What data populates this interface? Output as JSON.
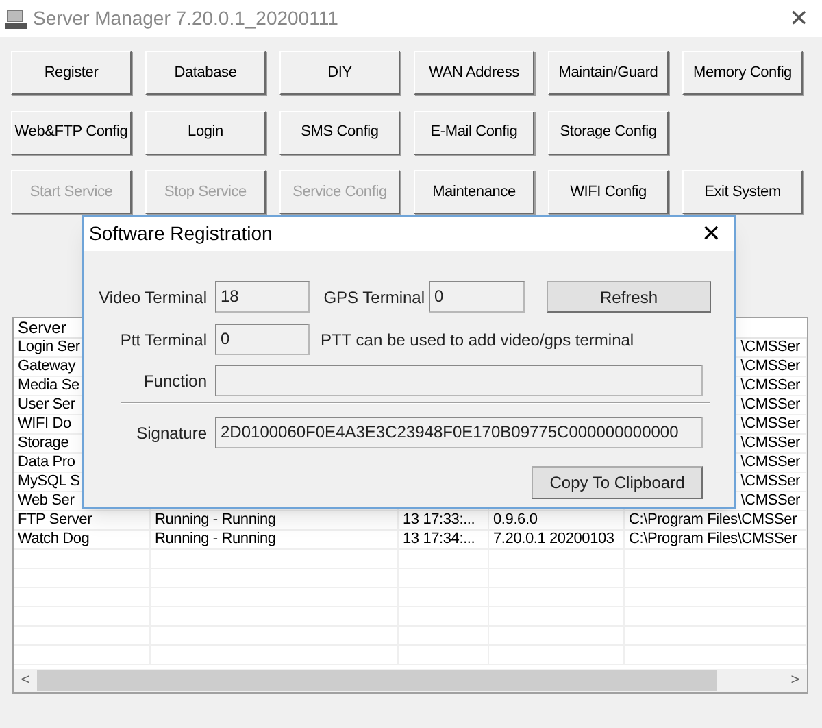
{
  "window": {
    "title": "Server Manager 7.20.0.1_20200111",
    "close": "✕"
  },
  "buttons": [
    {
      "label": "Register",
      "disabled": false
    },
    {
      "label": "Database",
      "disabled": false
    },
    {
      "label": "DIY",
      "disabled": false
    },
    {
      "label": "WAN Address",
      "disabled": false
    },
    {
      "label": "Maintain/Guard",
      "disabled": false
    },
    {
      "label": "Memory Config",
      "disabled": false
    },
    {
      "label": "Web&FTP Config",
      "disabled": false
    },
    {
      "label": "Login",
      "disabled": false
    },
    {
      "label": "SMS Config",
      "disabled": false
    },
    {
      "label": "E-Mail Config",
      "disabled": false
    },
    {
      "label": "Storage Config",
      "disabled": false
    },
    {
      "label": "Start Service",
      "disabled": true
    },
    {
      "label": "Stop Service",
      "disabled": true
    },
    {
      "label": "Service Config",
      "disabled": true
    },
    {
      "label": "Maintenance",
      "disabled": false
    },
    {
      "label": "WIFI Config",
      "disabled": false
    },
    {
      "label": "Exit System",
      "disabled": false
    }
  ],
  "table": {
    "columns": [
      "Server"
    ],
    "rows": [
      {
        "server": "Login Ser",
        "path": "\\CMSSer"
      },
      {
        "server": "Gateway",
        "path": "\\CMSSer"
      },
      {
        "server": "Media Se",
        "path": "\\CMSSer"
      },
      {
        "server": "User Ser",
        "path": "\\CMSSer"
      },
      {
        "server": "WIFI Do",
        "path": "\\CMSSer"
      },
      {
        "server": "Storage",
        "path": "\\CMSSer"
      },
      {
        "server": "Data Pro",
        "path": "\\CMSSer"
      },
      {
        "server": "MySQL S",
        "path": "\\CMSSer"
      },
      {
        "server": "Web Ser",
        "path": "\\CMSSer"
      },
      {
        "server": "FTP Server",
        "status": "Running - Running",
        "time": "13 17:33:...",
        "version": "0.9.6.0",
        "path": "C:\\Program Files\\CMSSer"
      },
      {
        "server": "Watch Dog",
        "status": "Running - Running",
        "time": "13 17:34:...",
        "version": "7.20.0.1 20200103",
        "path": "C:\\Program Files\\CMSSer"
      }
    ],
    "scroll_left": "<",
    "scroll_right": ">"
  },
  "dialog": {
    "title": "Software Registration",
    "close": "✕",
    "video_terminal": {
      "label": "Video Terminal",
      "value": "18"
    },
    "gps_terminal": {
      "label": "GPS Terminal",
      "value": "0"
    },
    "refresh": "Refresh",
    "ptt_terminal": {
      "label": "Ptt Terminal",
      "value": "0"
    },
    "ptt_note": "PTT can be used to add video/gps terminal",
    "function": {
      "label": "Function"
    },
    "signature": {
      "label": "Signature",
      "value": "2D0100060F0E4A3E3C23948F0E170B09775C000000000000"
    },
    "copy": "Copy To Clipboard"
  }
}
